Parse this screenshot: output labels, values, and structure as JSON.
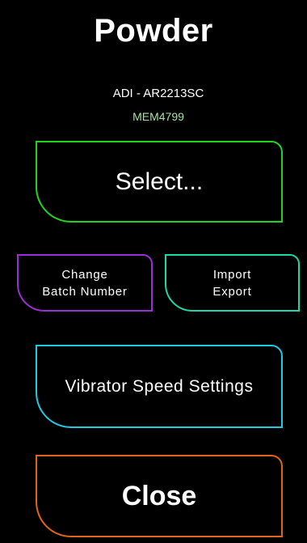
{
  "header": {
    "title": "Powder",
    "powder_name": "ADI - AR2213SC",
    "lot_code": "MEM4799"
  },
  "buttons": {
    "select": {
      "label": "Select..."
    },
    "batch": {
      "line1": "Change",
      "line2": "Batch Number"
    },
    "import_export": {
      "line1": "Import",
      "line2": "Export"
    },
    "vibrator": {
      "label": "Vibrator Speed Settings"
    },
    "close": {
      "label": "Close"
    }
  },
  "colors": {
    "background": "#000000",
    "lot_code": "#a6e3a1",
    "select_border": "#22d322",
    "batch_border": "#9b2fd6",
    "import_export_border": "#1fd6a6",
    "vibrator_border": "#1fc9e0",
    "close_border": "#e0641a"
  }
}
